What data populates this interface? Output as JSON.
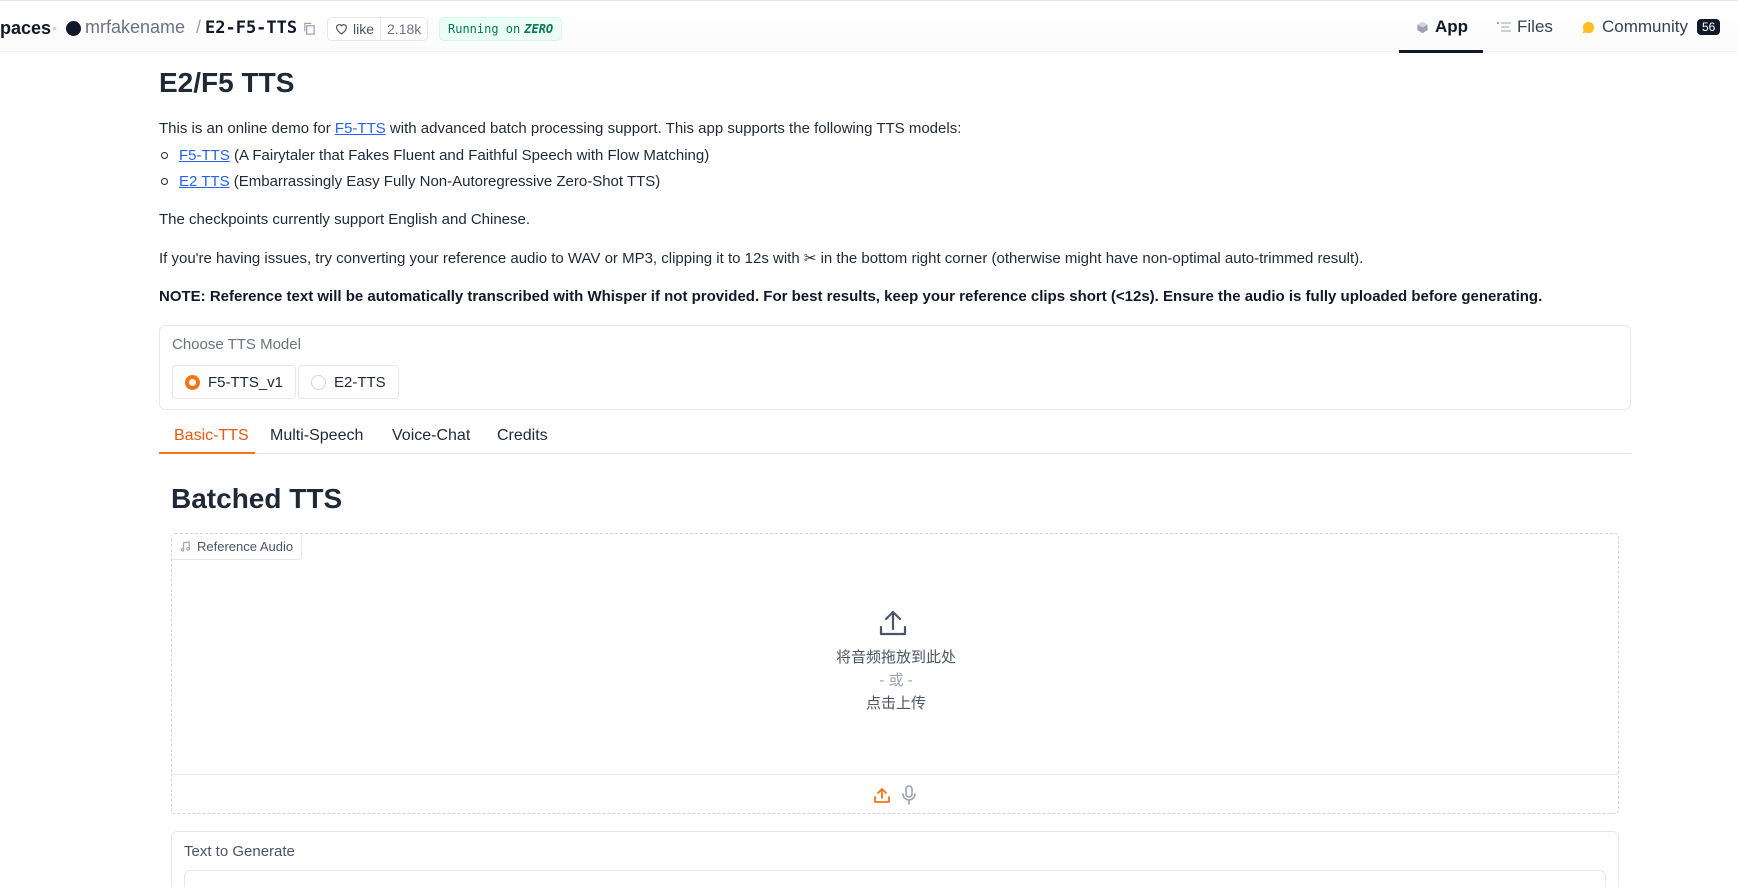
{
  "header": {
    "brand": "paces",
    "owner": "mrfakename",
    "separator": "/",
    "repo": "E2-F5-TTS",
    "like_label": "like",
    "like_count": "2.18k",
    "running_prefix": "Running on",
    "running_hw": "ZERO",
    "nav": {
      "app": "App",
      "files": "Files",
      "community": "Community",
      "community_count": "56"
    }
  },
  "main": {
    "title": "E2/F5 TTS",
    "intro_prefix": "This is an online demo for ",
    "intro_link": "F5-TTS",
    "intro_suffix": " with advanced batch processing support. This app supports the following TTS models:",
    "models_list": [
      {
        "link": "F5-TTS",
        "desc": " (A Fairytaler that Fakes Fluent and Faithful Speech with Flow Matching)"
      },
      {
        "link": "E2 TTS",
        "desc": " (Embarrassingly Easy Fully Non-Autoregressive Zero-Shot TTS)"
      }
    ],
    "checkpoints_text": "The checkpoints currently support English and Chinese.",
    "issues_text": "If you're having issues, try converting your reference audio to WAV or MP3, clipping it to 12s with ✂ in the bottom right corner (otherwise might have non-optimal auto-trimmed result).",
    "note_text": "NOTE: Reference text will be automatically transcribed with Whisper if not provided. For best results, keep your reference clips short (<12s). Ensure the audio is fully uploaded before generating."
  },
  "model_choice": {
    "label": "Choose TTS Model",
    "options": [
      "F5-TTS_v1",
      "E2-TTS"
    ],
    "selected": "F5-TTS_v1"
  },
  "tabs": [
    "Basic-TTS",
    "Multi-Speech",
    "Voice-Chat",
    "Credits"
  ],
  "basic": {
    "title": "Batched TTS",
    "ref_audio_label": "Reference Audio",
    "drop_text": "将音频拖放到此处",
    "or_text": "- 或 -",
    "click_text": "点击上传",
    "text_label": "Text to Generate"
  },
  "colors": {
    "accent": "#f97316",
    "link": "#2563eb",
    "running_bg": "#ecfdf5",
    "running_text": "#047857"
  }
}
